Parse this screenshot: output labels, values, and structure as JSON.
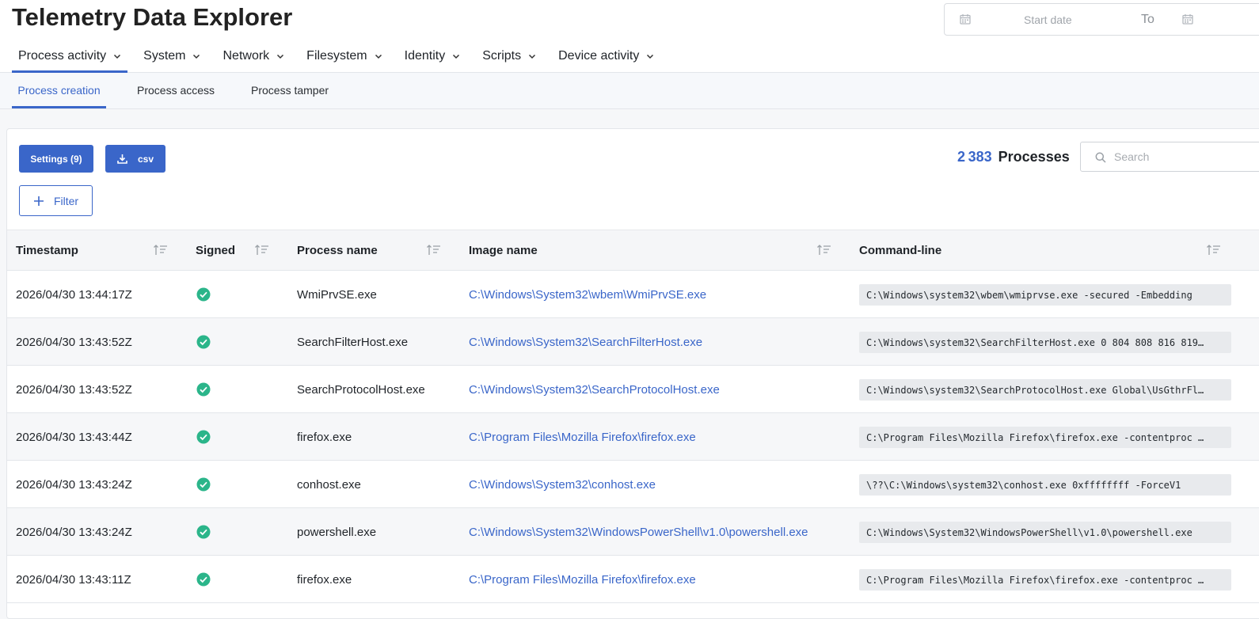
{
  "app": {
    "title": "Telemetry Data Explorer"
  },
  "date_range": {
    "start_placeholder": "Start date",
    "separator": "To",
    "icon": "calendar-icon"
  },
  "main_tabs": [
    {
      "label": "Process activity",
      "active": true
    },
    {
      "label": "System"
    },
    {
      "label": "Network"
    },
    {
      "label": "Filesystem"
    },
    {
      "label": "Identity"
    },
    {
      "label": "Scripts"
    },
    {
      "label": "Device activity"
    }
  ],
  "sub_tabs": [
    {
      "label": "Process creation",
      "active": true
    },
    {
      "label": "Process access"
    },
    {
      "label": "Process tamper"
    }
  ],
  "toolbar": {
    "settings_label": "Settings (9)",
    "csv_label": "csv",
    "filter_label": "Filter",
    "count_value": "2 383",
    "count_label": "Processes",
    "search_placeholder": "Search"
  },
  "table": {
    "columns": [
      "Timestamp",
      "Signed",
      "Process name",
      "Image name",
      "Command-line"
    ],
    "rows": [
      {
        "timestamp": "2026/04/30 13:44:17Z",
        "signed": true,
        "process": "WmiPrvSE.exe",
        "image": "C:\\Windows\\System32\\wbem\\WmiPrvSE.exe",
        "cmd": "C:\\Windows\\system32\\wbem\\wmiprvse.exe -secured -Embedding"
      },
      {
        "timestamp": "2026/04/30 13:43:52Z",
        "signed": true,
        "process": "SearchFilterHost.exe",
        "image": "C:\\Windows\\System32\\SearchFilterHost.exe",
        "cmd": "C:\\Windows\\system32\\SearchFilterHost.exe 0 804 808 816 819…"
      },
      {
        "timestamp": "2026/04/30 13:43:52Z",
        "signed": true,
        "process": "SearchProtocolHost.exe",
        "image": "C:\\Windows\\System32\\SearchProtocolHost.exe",
        "cmd": "C:\\Windows\\system32\\SearchProtocolHost.exe Global\\UsGthrFl…"
      },
      {
        "timestamp": "2026/04/30 13:43:44Z",
        "signed": true,
        "process": "firefox.exe",
        "image": "C:\\Program Files\\Mozilla Firefox\\firefox.exe",
        "cmd": "C:\\Program Files\\Mozilla Firefox\\firefox.exe -contentproc …"
      },
      {
        "timestamp": "2026/04/30 13:43:24Z",
        "signed": true,
        "process": "conhost.exe",
        "image": "C:\\Windows\\System32\\conhost.exe",
        "cmd": "\\??\\C:\\Windows\\system32\\conhost.exe 0xffffffff -ForceV1"
      },
      {
        "timestamp": "2026/04/30 13:43:24Z",
        "signed": true,
        "process": "powershell.exe",
        "image": "C:\\Windows\\System32\\WindowsPowerShell\\v1.0\\powershell.exe",
        "cmd": "C:\\Windows\\System32\\WindowsPowerShell\\v1.0\\powershell.exe"
      },
      {
        "timestamp": "2026/04/30 13:43:11Z",
        "signed": true,
        "process": "firefox.exe",
        "image": "C:\\Program Files\\Mozilla Firefox\\firefox.exe",
        "cmd": "C:\\Program Files\\Mozilla Firefox\\firefox.exe -contentproc …"
      }
    ]
  },
  "colors": {
    "accent": "#3a66c9",
    "signed_ok": "#2bb58a",
    "code_bg": "#e8eaed"
  }
}
